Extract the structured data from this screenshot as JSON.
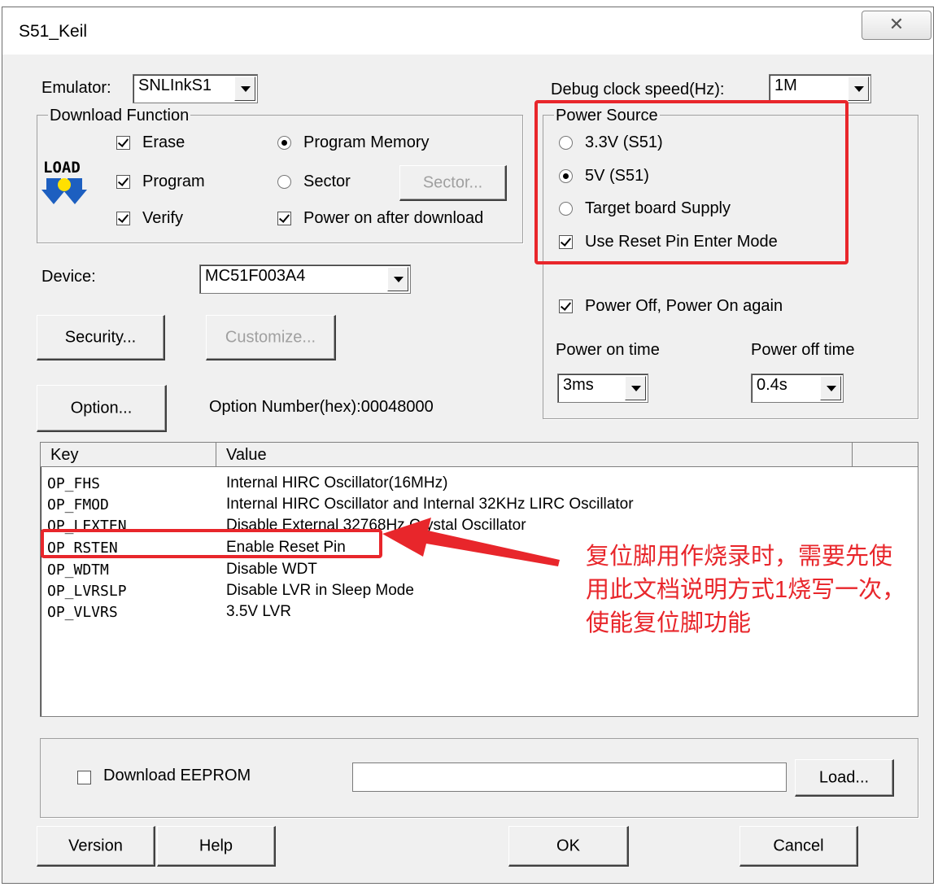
{
  "window": {
    "title": "S51_Keil",
    "close_glyph": "✕"
  },
  "emulator": {
    "label": "Emulator:",
    "value": "SNLInkS1"
  },
  "debug_clock": {
    "label": "Debug clock speed(Hz):",
    "value": "1M"
  },
  "download_function": {
    "title": "Download Function",
    "icon_text": "LOAD",
    "erase": "Erase",
    "program": "Program",
    "verify": "Verify",
    "program_memory": "Program Memory",
    "sector": "Sector",
    "sector_button": "Sector...",
    "power_on_after": "Power on after download"
  },
  "power_source": {
    "title": "Power Source",
    "opt_33": "3.3V (S51)",
    "opt_5": "5V (S51)",
    "opt_target": "Target board Supply",
    "reset_pin": "Use Reset Pin Enter Mode",
    "power_cycle": "Power Off, Power On again",
    "on_time_label": "Power on time",
    "off_time_label": "Power off time",
    "on_time_value": "3ms",
    "off_time_value": "0.4s"
  },
  "device": {
    "label": "Device:",
    "value": "MC51F003A4"
  },
  "buttons": {
    "security": "Security...",
    "customize": "Customize...",
    "option": "Option...",
    "load": "Load...",
    "version": "Version",
    "help": "Help",
    "ok": "OK",
    "cancel": "Cancel"
  },
  "option_number": "Option Number(hex):00048000",
  "table": {
    "headers": [
      "Key",
      "Value"
    ],
    "rows": [
      {
        "key": "OP_FHS",
        "value": "Internal HIRC Oscillator(16MHz)"
      },
      {
        "key": "OP_FMOD",
        "value": "Internal HIRC Oscillator and Internal 32KHz LIRC Oscillator"
      },
      {
        "key": "OP_LEXTEN",
        "value": "Disable External 32768Hz Crystal Oscillator"
      },
      {
        "key": "OP_RSTEN",
        "value": "Enable Reset Pin"
      },
      {
        "key": "OP_WDTM",
        "value": "Disable WDT"
      },
      {
        "key": "OP_LVRSLP",
        "value": "Disable LVR in Sleep Mode"
      },
      {
        "key": "OP_VLVRS",
        "value": "3.5V LVR"
      }
    ]
  },
  "eeprom": {
    "label": "Download EEPROM",
    "path": ""
  },
  "annotation": {
    "line1": "复位脚用作烧录时，需要先使",
    "line2": "用此文档说明方式1烧写一次，",
    "line3": "使能复位脚功能",
    "color": "#e8262b"
  }
}
